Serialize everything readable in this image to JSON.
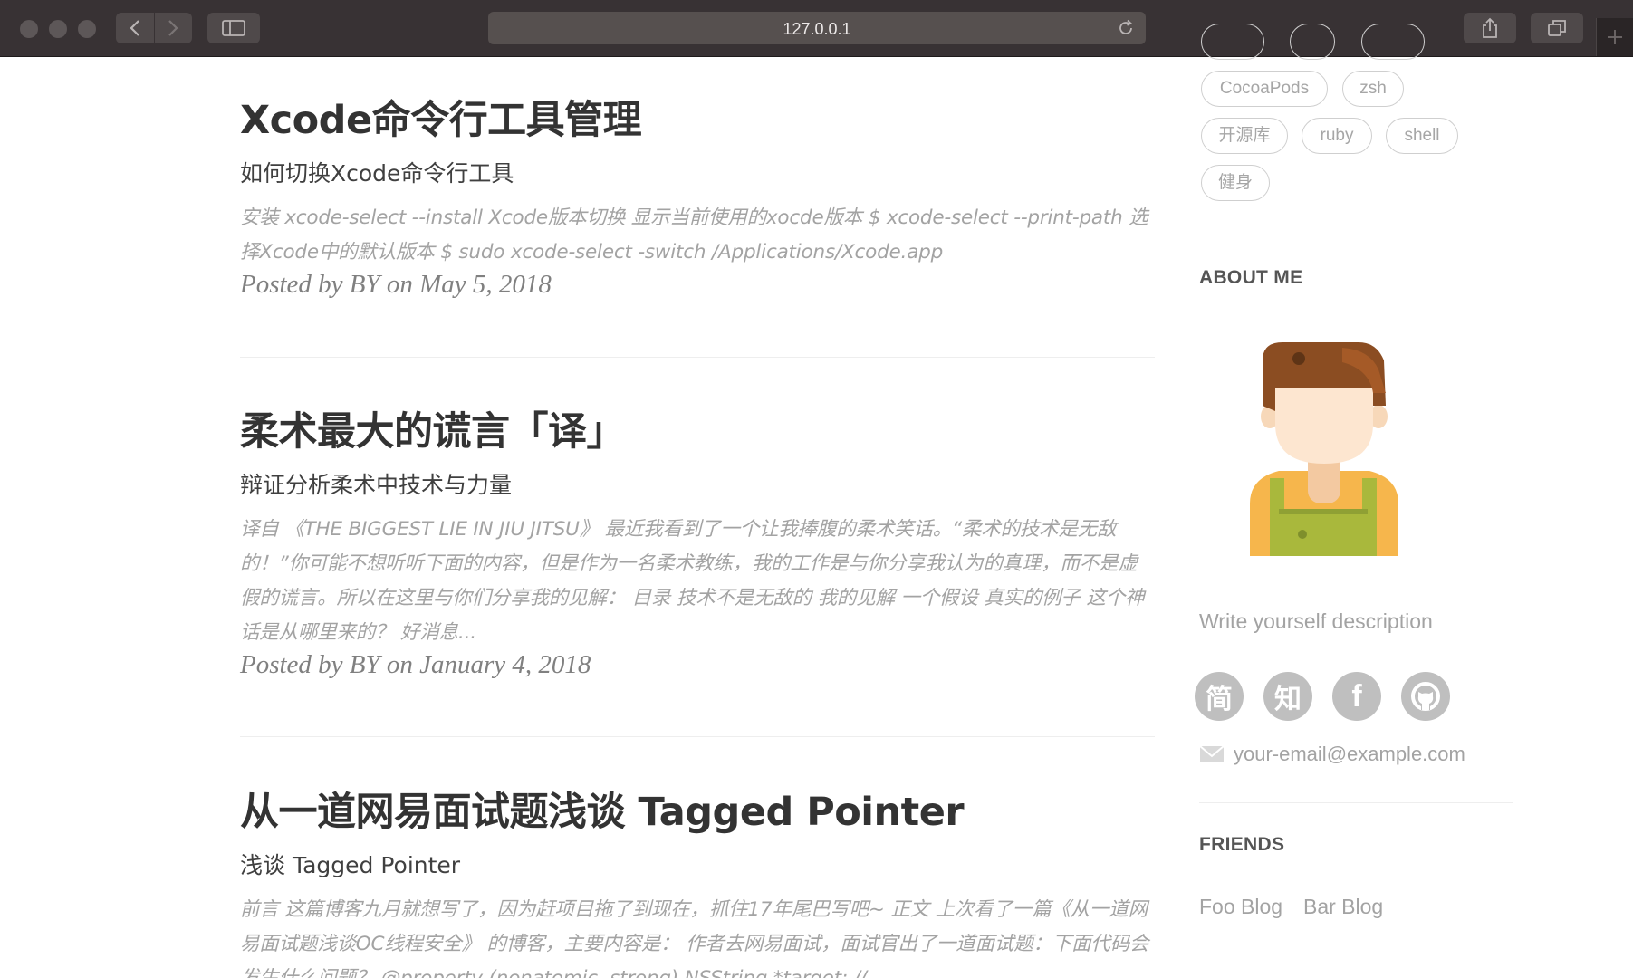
{
  "browser": {
    "url": "127.0.0.1"
  },
  "posts": [
    {
      "title": "Xcode命令行工具管理",
      "subtitle": "如何切换Xcode命令行工具",
      "excerpt": "安装 xcode-select --install Xcode版本切换 显示当前使用的xocde版本 $ xcode-select --print-path 选择Xcode中的默认版本 $ sudo xcode-select -switch /Applications/Xcode.app",
      "meta": "Posted by BY on May 5, 2018"
    },
    {
      "title": "柔术最大的谎言「译」",
      "subtitle": "辩证分析柔术中技术与力量",
      "excerpt": "译自 《THE BIGGEST LIE IN JIU JITSU》 最近我看到了一个让我捧腹的柔术笑话。“柔术的技术是无敌的！”你可能不想听听下面的内容，但是作为一名柔术教练，我的工作是与你分享我认为的真理，而不是虚假的谎言。所以在这里与你们分享我的见解： 目录 技术不是无敌的 我的见解 一个假设 真实的例子 这个神话是从哪里来的？ 好消息...",
      "meta": "Posted by BY on January 4, 2018"
    },
    {
      "title": "从一道网易面试题浅谈 Tagged Pointer",
      "subtitle": "浅谈 Tagged Pointer",
      "excerpt": "前言 这篇博客九月就想写了，因为赶项目拖了到现在，抓住17年尾巴写吧~ 正文 上次看了一篇《从一道网易面试题浅谈OC线程安全》 的博客，主要内容是： 作者去网易面试，面试官出了一道面试题：下面代码会发生什么问题？ @property (nonatomic, strong) NSString *target; //"
    }
  ],
  "sidebar": {
    "tags": [
      "CocoaPods",
      "zsh",
      "开源库",
      "ruby",
      "shell",
      "健身"
    ],
    "about": {
      "heading": "ABOUT ME",
      "description": "Write yourself description",
      "social": [
        {
          "label": "简",
          "icon": "jianshu-icon"
        },
        {
          "label": "知",
          "icon": "zhihu-icon"
        },
        {
          "label": "f",
          "icon": "facebook-icon"
        },
        {
          "label": "",
          "icon": "github-icon"
        }
      ],
      "email": "your-email@example.com"
    },
    "friends": {
      "heading": "FRIENDS",
      "links": [
        "Foo Blog",
        "Bar Blog"
      ]
    }
  }
}
